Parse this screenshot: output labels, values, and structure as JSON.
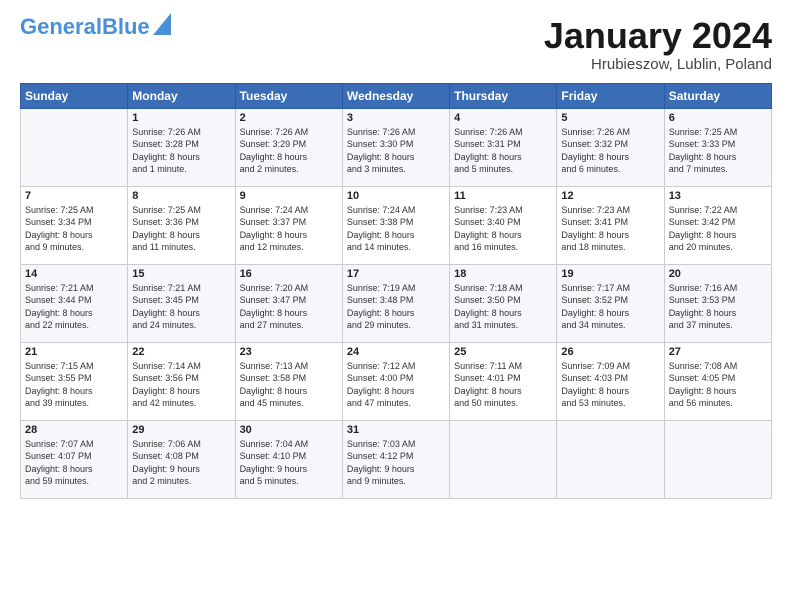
{
  "header": {
    "logo_general": "General",
    "logo_blue": "Blue",
    "month_title": "January 2024",
    "location": "Hrubieszow, Lublin, Poland"
  },
  "days_of_week": [
    "Sunday",
    "Monday",
    "Tuesday",
    "Wednesday",
    "Thursday",
    "Friday",
    "Saturday"
  ],
  "weeks": [
    [
      {
        "day": "",
        "content": ""
      },
      {
        "day": "1",
        "content": "Sunrise: 7:26 AM\nSunset: 3:28 PM\nDaylight: 8 hours\nand 1 minute."
      },
      {
        "day": "2",
        "content": "Sunrise: 7:26 AM\nSunset: 3:29 PM\nDaylight: 8 hours\nand 2 minutes."
      },
      {
        "day": "3",
        "content": "Sunrise: 7:26 AM\nSunset: 3:30 PM\nDaylight: 8 hours\nand 3 minutes."
      },
      {
        "day": "4",
        "content": "Sunrise: 7:26 AM\nSunset: 3:31 PM\nDaylight: 8 hours\nand 5 minutes."
      },
      {
        "day": "5",
        "content": "Sunrise: 7:26 AM\nSunset: 3:32 PM\nDaylight: 8 hours\nand 6 minutes."
      },
      {
        "day": "6",
        "content": "Sunrise: 7:25 AM\nSunset: 3:33 PM\nDaylight: 8 hours\nand 7 minutes."
      }
    ],
    [
      {
        "day": "7",
        "content": "Sunrise: 7:25 AM\nSunset: 3:34 PM\nDaylight: 8 hours\nand 9 minutes."
      },
      {
        "day": "8",
        "content": "Sunrise: 7:25 AM\nSunset: 3:36 PM\nDaylight: 8 hours\nand 11 minutes."
      },
      {
        "day": "9",
        "content": "Sunrise: 7:24 AM\nSunset: 3:37 PM\nDaylight: 8 hours\nand 12 minutes."
      },
      {
        "day": "10",
        "content": "Sunrise: 7:24 AM\nSunset: 3:38 PM\nDaylight: 8 hours\nand 14 minutes."
      },
      {
        "day": "11",
        "content": "Sunrise: 7:23 AM\nSunset: 3:40 PM\nDaylight: 8 hours\nand 16 minutes."
      },
      {
        "day": "12",
        "content": "Sunrise: 7:23 AM\nSunset: 3:41 PM\nDaylight: 8 hours\nand 18 minutes."
      },
      {
        "day": "13",
        "content": "Sunrise: 7:22 AM\nSunset: 3:42 PM\nDaylight: 8 hours\nand 20 minutes."
      }
    ],
    [
      {
        "day": "14",
        "content": "Sunrise: 7:21 AM\nSunset: 3:44 PM\nDaylight: 8 hours\nand 22 minutes."
      },
      {
        "day": "15",
        "content": "Sunrise: 7:21 AM\nSunset: 3:45 PM\nDaylight: 8 hours\nand 24 minutes."
      },
      {
        "day": "16",
        "content": "Sunrise: 7:20 AM\nSunset: 3:47 PM\nDaylight: 8 hours\nand 27 minutes."
      },
      {
        "day": "17",
        "content": "Sunrise: 7:19 AM\nSunset: 3:48 PM\nDaylight: 8 hours\nand 29 minutes."
      },
      {
        "day": "18",
        "content": "Sunrise: 7:18 AM\nSunset: 3:50 PM\nDaylight: 8 hours\nand 31 minutes."
      },
      {
        "day": "19",
        "content": "Sunrise: 7:17 AM\nSunset: 3:52 PM\nDaylight: 8 hours\nand 34 minutes."
      },
      {
        "day": "20",
        "content": "Sunrise: 7:16 AM\nSunset: 3:53 PM\nDaylight: 8 hours\nand 37 minutes."
      }
    ],
    [
      {
        "day": "21",
        "content": "Sunrise: 7:15 AM\nSunset: 3:55 PM\nDaylight: 8 hours\nand 39 minutes."
      },
      {
        "day": "22",
        "content": "Sunrise: 7:14 AM\nSunset: 3:56 PM\nDaylight: 8 hours\nand 42 minutes."
      },
      {
        "day": "23",
        "content": "Sunrise: 7:13 AM\nSunset: 3:58 PM\nDaylight: 8 hours\nand 45 minutes."
      },
      {
        "day": "24",
        "content": "Sunrise: 7:12 AM\nSunset: 4:00 PM\nDaylight: 8 hours\nand 47 minutes."
      },
      {
        "day": "25",
        "content": "Sunrise: 7:11 AM\nSunset: 4:01 PM\nDaylight: 8 hours\nand 50 minutes."
      },
      {
        "day": "26",
        "content": "Sunrise: 7:09 AM\nSunset: 4:03 PM\nDaylight: 8 hours\nand 53 minutes."
      },
      {
        "day": "27",
        "content": "Sunrise: 7:08 AM\nSunset: 4:05 PM\nDaylight: 8 hours\nand 56 minutes."
      }
    ],
    [
      {
        "day": "28",
        "content": "Sunrise: 7:07 AM\nSunset: 4:07 PM\nDaylight: 8 hours\nand 59 minutes."
      },
      {
        "day": "29",
        "content": "Sunrise: 7:06 AM\nSunset: 4:08 PM\nDaylight: 9 hours\nand 2 minutes."
      },
      {
        "day": "30",
        "content": "Sunrise: 7:04 AM\nSunset: 4:10 PM\nDaylight: 9 hours\nand 5 minutes."
      },
      {
        "day": "31",
        "content": "Sunrise: 7:03 AM\nSunset: 4:12 PM\nDaylight: 9 hours\nand 9 minutes."
      },
      {
        "day": "",
        "content": ""
      },
      {
        "day": "",
        "content": ""
      },
      {
        "day": "",
        "content": ""
      }
    ]
  ]
}
